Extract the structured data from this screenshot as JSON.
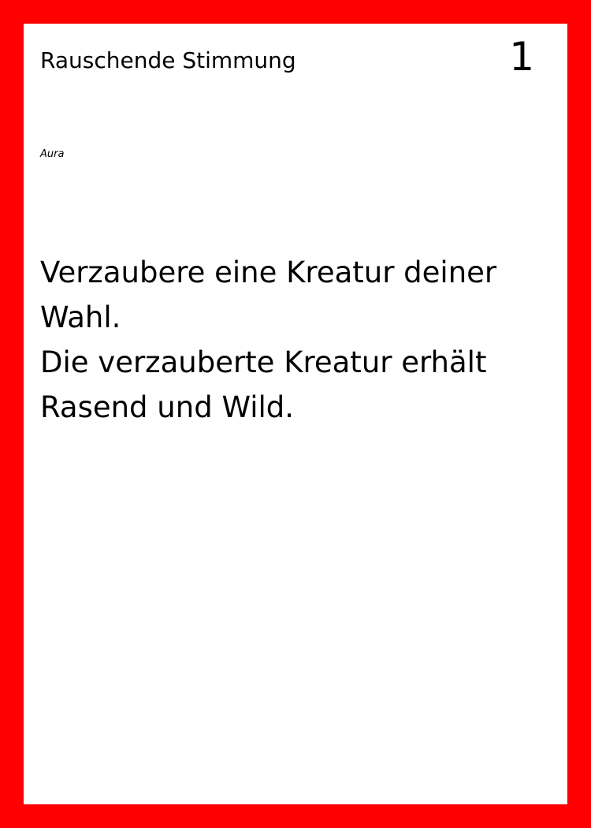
{
  "card": {
    "title": "Rauschende Stimmung",
    "cost": "1",
    "type": "Aura",
    "text_lines": [
      "Verzaubere eine Kreatur deiner",
      "Wahl.",
      "Die verzauberte Kreatur erhält",
      "Rasend und Wild."
    ],
    "colors": {
      "border": "#ff0000",
      "background": "#ffffff",
      "text": "#000000"
    }
  }
}
